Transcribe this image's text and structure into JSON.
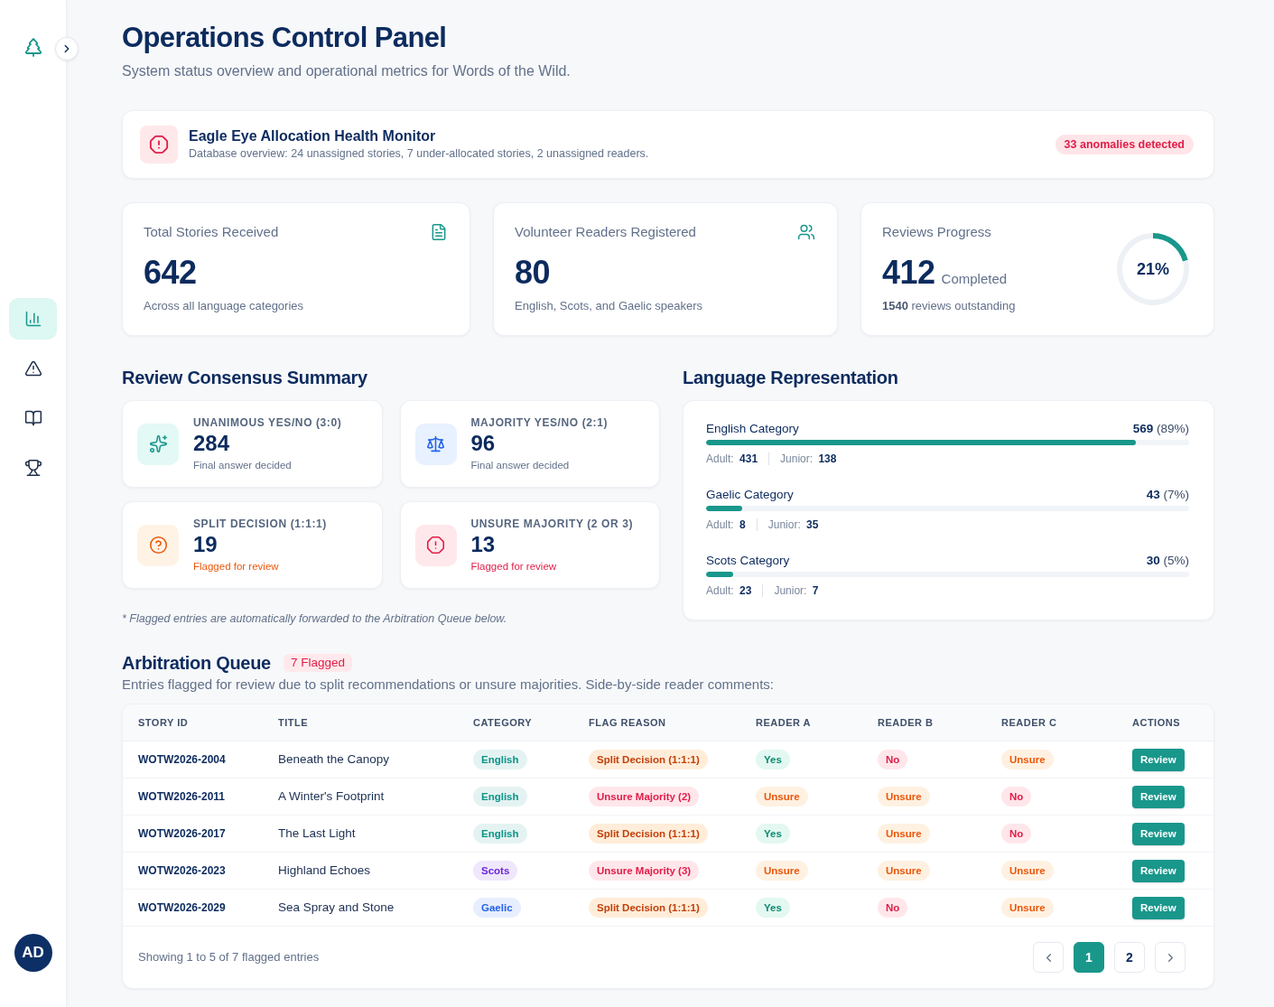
{
  "sidebar": {
    "nav": [
      {
        "kind": "chart",
        "selected": true
      },
      {
        "kind": "alert",
        "selected": false
      },
      {
        "kind": "book",
        "selected": false
      },
      {
        "kind": "trophy",
        "selected": false
      }
    ],
    "avatar": "AD"
  },
  "header": {
    "title": "Operations Control Panel",
    "subtitle": "System status overview and operational metrics for Words of the Wild."
  },
  "alert": {
    "title": "Eagle Eye Allocation Health Monitor",
    "description": "Database overview: 24 unassigned stories, 7 under-allocated stories, 2 unassigned readers.",
    "badge": "33 anomalies detected"
  },
  "stats": [
    {
      "kind": "stories",
      "label": "Total Stories Received",
      "value": "642",
      "note": "Across all language categories"
    },
    {
      "kind": "readers",
      "label": "Volunteer Readers Registered",
      "value": "80",
      "note": "English, Scots, and Gaelic speakers"
    },
    {
      "kind": "progress",
      "label": "Reviews Progress",
      "value": "412",
      "unit": "Completed",
      "note": "**1540** reviews outstanding",
      "percent": "21%",
      "chart_data": {
        "type": "donut",
        "values": [
          21,
          79
        ]
      }
    }
  ],
  "consensus": {
    "title": "Review Consensus Summary",
    "cards": [
      {
        "kind": "unanimous",
        "label": "UNANIMOUS YES/NO (3:0)",
        "value": "284",
        "note": "Final answer decided"
      },
      {
        "kind": "majority",
        "label": "MAJORITY YES/NO (2:1)",
        "value": "96",
        "note": "Final answer decided"
      },
      {
        "kind": "split",
        "label": "SPLIT DECISION (1:1:1)",
        "value": "19",
        "note": "Flagged for review"
      },
      {
        "kind": "unsure",
        "label": "UNSURE MAJORITY (2 OR 3)",
        "value": "13",
        "note": "Flagged for review"
      }
    ],
    "footnote": "* Flagged entries are automatically forwarded to the Arbitration Queue below."
  },
  "languages": {
    "title": "Language Representation",
    "rows": [
      {
        "label": "English Category",
        "total": "**569** (89%)",
        "level": 0.89,
        "adult": "Adult: **431**",
        "junior": "Junior: **138**"
      },
      {
        "label": "Gaelic Category",
        "total": "**43** (7%)",
        "level": 0.074,
        "adult": "Adult: **8**",
        "junior": "Junior: **35**"
      },
      {
        "label": "Scots Category",
        "total": "**30** (5%)",
        "level": 0.056,
        "adult": "Adult: **23**",
        "junior": "Junior: **7**"
      }
    ]
  },
  "queue": {
    "title": "Arbitration Queue",
    "badge": "7 Flagged",
    "description": "Entries flagged for review due to split recommendations or unsure majorities. Side-by-side reader comments:",
    "columns": [
      "STORY ID",
      "TITLE",
      "CATEGORY",
      "FLAG REASON",
      "READER A",
      "READER B",
      "READER C",
      "ACTIONS"
    ],
    "rows": [
      {
        "story_id": "WOTW2026-2004",
        "title": "Beneath the Canopy",
        "category": {
          "label": "English",
          "color": "#0d9488"
        },
        "flag": {
          "label": "Split Decision (1:1:1)",
          "kind": "split"
        },
        "readers": [
          {
            "label": "Yes",
            "kind": "yes"
          },
          {
            "label": "No",
            "kind": "no"
          },
          {
            "label": "Unsure",
            "kind": "unsure"
          }
        ],
        "action": "Review"
      },
      {
        "story_id": "WOTW2026-2011",
        "title": "A Winter's Footprint",
        "category": {
          "label": "English",
          "color": "#0d9488"
        },
        "flag": {
          "label": "Unsure Majority (2)",
          "kind": "unsure"
        },
        "readers": [
          {
            "label": "Unsure",
            "kind": "unsure"
          },
          {
            "label": "Unsure",
            "kind": "unsure"
          },
          {
            "label": "No",
            "kind": "no"
          }
        ],
        "action": "Review"
      },
      {
        "story_id": "WOTW2026-2017",
        "title": "The Last Light",
        "category": {
          "label": "English",
          "color": "#0d9488"
        },
        "flag": {
          "label": "Split Decision (1:1:1)",
          "kind": "split"
        },
        "readers": [
          {
            "label": "Yes",
            "kind": "yes"
          },
          {
            "label": "Unsure",
            "kind": "unsure"
          },
          {
            "label": "No",
            "kind": "no"
          }
        ],
        "action": "Review"
      },
      {
        "story_id": "WOTW2026-2023",
        "title": "Highland Echoes",
        "category": {
          "label": "Scots",
          "color": "#6d28d9"
        },
        "flag": {
          "label": "Unsure Majority (3)",
          "kind": "unsure"
        },
        "readers": [
          {
            "label": "Unsure",
            "kind": "unsure"
          },
          {
            "label": "Unsure",
            "kind": "unsure"
          },
          {
            "label": "Unsure",
            "kind": "unsure"
          }
        ],
        "action": "Review"
      },
      {
        "story_id": "WOTW2026-2029",
        "title": "Sea Spray and Stone",
        "category": {
          "label": "Gaelic",
          "color": "#2563eb"
        },
        "flag": {
          "label": "Split Decision (1:1:1)",
          "kind": "split"
        },
        "readers": [
          {
            "label": "Yes",
            "kind": "yes"
          },
          {
            "label": "No",
            "kind": "no"
          },
          {
            "label": "Unsure",
            "kind": "unsure"
          }
        ],
        "action": "Review"
      }
    ],
    "footer": "Showing 1 to 5 of 7 flagged entries",
    "pages": [
      {
        "label": "1",
        "selected": true
      },
      {
        "label": "2",
        "selected": false
      }
    ]
  }
}
